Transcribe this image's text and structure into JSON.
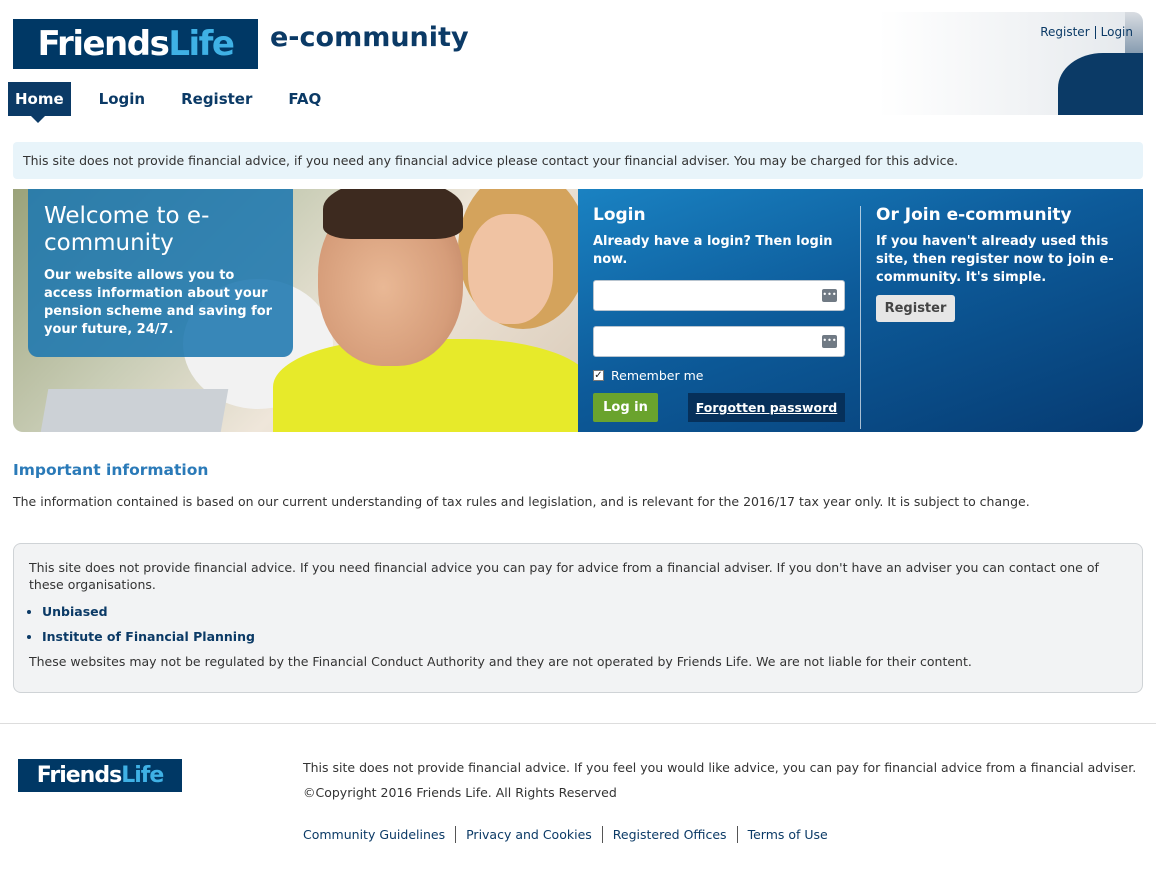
{
  "header": {
    "logo_friends": "Friends",
    "logo_life": "Life",
    "site_title": "e-community",
    "top_links": [
      "Register",
      "Login"
    ]
  },
  "nav": {
    "items": [
      "Home",
      "Login",
      "Register",
      "FAQ"
    ],
    "active": "Home"
  },
  "notice": {
    "text": "This site does not provide financial advice, if you need any financial advice please contact your financial adviser. You may be charged for this advice."
  },
  "hero": {
    "welcome_title": "Welcome to e-community",
    "welcome_text": "Our website allows you to access information about your pension scheme and saving for your future, 24/7."
  },
  "login": {
    "title": "Login",
    "subtitle": "Already have a login? Then login now.",
    "username_value": "",
    "password_value": "",
    "remember_label": "Remember me",
    "remember_checked": true,
    "login_button": "Log in",
    "forgot_button": "Forgotten password"
  },
  "join": {
    "title": "Or Join e-community",
    "text": "If you haven't already used this site, then register now to join e-community. It's simple.",
    "register_button": "Register"
  },
  "important": {
    "heading": "Important information",
    "text": "The information contained is based on our current understanding of tax rules and legislation, and is relevant for the 2016/17 tax year only. It is subject to change."
  },
  "advice": {
    "intro": "This site does not provide financial advice. If you need financial advice you can pay for advice from a financial adviser. If you don't have an adviser you can contact one of these organisations.",
    "links": [
      "Unbiased",
      "Institute of Financial Planning"
    ],
    "footnote": "These websites may not be regulated by the Financial Conduct Authority and they are not operated by Friends Life. We are not liable for their content."
  },
  "footer": {
    "disclaimer": "This site does not provide financial advice. If you feel you would like advice, you can pay for financial advice from a financial adviser.",
    "copyright": "©Copyright 2016 Friends Life. All Rights Reserved",
    "links": [
      "Community Guidelines",
      "Privacy and Cookies",
      "Registered Offices",
      "Terms of Use"
    ]
  },
  "colors": {
    "brand_navy": "#003865",
    "brand_light_blue": "#3fb1e5",
    "link_blue": "#0b3a66",
    "heading_blue": "#2a7ab8",
    "login_green": "#6aa32d",
    "notice_bg": "#e8f4fa"
  }
}
